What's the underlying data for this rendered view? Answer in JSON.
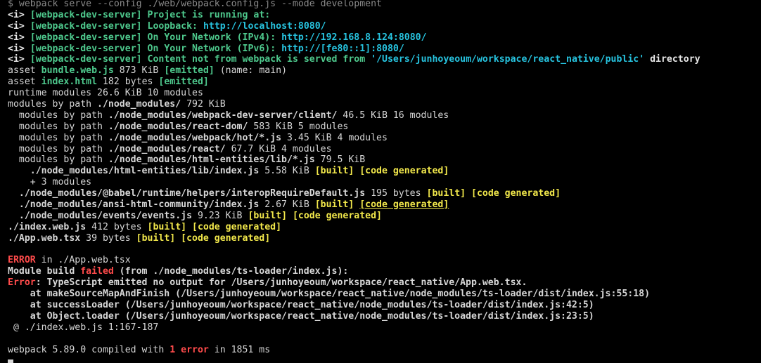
{
  "command": "$ webpack serve --config ./web/webpack.config.js --mode development",
  "info_prefix": "<i>",
  "server_tag": "[webpack-dev-server]",
  "lines": {
    "l1": "Project is running at:",
    "l2a": "Loopback: ",
    "l2b": "http://localhost:8080/",
    "l3a": "On Your Network (IPv4): ",
    "l3b": "http://192.168.8.124:8080/",
    "l4a": "On Your Network (IPv6): ",
    "l4b": "http://[fe80::1]:8080/",
    "l5a": "Content not from webpack is served from ",
    "l5b": "'/Users/junhoyeoum/workspace/react_native/public'",
    "l5c": " directory"
  },
  "assets": [
    {
      "prefix": "asset ",
      "name": "bundle.web.js",
      "size": " 873 KiB ",
      "tag": "[emitted]",
      "extra": " (name: main)"
    },
    {
      "prefix": "asset ",
      "name": "index.html",
      "size": " 182 bytes ",
      "tag": "[emitted]",
      "extra": ""
    }
  ],
  "runtime": "runtime modules 26.6 KiB 10 modules",
  "modules_by_path_root": {
    "label": "modules by path ",
    "path": "./node_modules/",
    "size": " 792 KiB"
  },
  "modules_by_path": [
    {
      "label": "  modules by path ",
      "path": "./node_modules/webpack-dev-server/client/",
      "size": " 46.5 KiB 16 modules"
    },
    {
      "label": "  modules by path ",
      "path": "./node_modules/react-dom/",
      "size": " 583 KiB 5 modules"
    },
    {
      "label": "  modules by path ",
      "path": "./node_modules/webpack/hot/*.js",
      "size": " 3.45 KiB 4 modules"
    },
    {
      "label": "  modules by path ",
      "path": "./node_modules/react/",
      "size": " 67.7 KiB 4 modules"
    },
    {
      "label": "  modules by path ",
      "path": "./node_modules/html-entities/lib/*.js",
      "size": " 79.5 KiB"
    }
  ],
  "built_modules": [
    {
      "indent": "    ",
      "path": "./node_modules/html-entities/lib/index.js",
      "size": " 5.58 KiB ",
      "built": "[built]",
      "gen": "[code generated]"
    },
    {
      "indent": "    ",
      "path": "+ 3 modules",
      "size": "",
      "built": "",
      "gen": ""
    },
    {
      "indent": "  ",
      "path": "./node_modules/@babel/runtime/helpers/interopRequireDefault.js",
      "size": " 195 bytes ",
      "built": "[built]",
      "gen": "[code generated]"
    },
    {
      "indent": "  ",
      "path": "./node_modules/ansi-html-community/index.js",
      "size": " 2.67 KiB ",
      "built": "[built]",
      "gen": "[code generated]"
    },
    {
      "indent": "  ",
      "path": "./node_modules/events/events.js",
      "size": " 9.23 KiB ",
      "built": "[built]",
      "gen": "[code generated]"
    },
    {
      "indent": "",
      "path": "./index.web.js",
      "size": " 412 bytes ",
      "built": "[built]",
      "gen": "[code generated]"
    },
    {
      "indent": "",
      "path": "./App.web.tsx",
      "size": " 39 bytes ",
      "built": "[built]",
      "gen": "[code generated]"
    }
  ],
  "error": {
    "label": "ERROR",
    "in": " in ./App.web.tsx",
    "build_a": "Module build ",
    "build_b": "failed",
    "build_c": " (from ./node_modules/ts-loader/index.js):",
    "err_label": "Error",
    "err_msg": ": TypeScript emitted no output for /Users/junhoyeoum/workspace/react_native/App.web.tsx.",
    "stack": [
      "    at makeSourceMapAndFinish (/Users/junhoyeoum/workspace/react_native/node_modules/ts-loader/dist/index.js:55:18)",
      "    at successLoader (/Users/junhoyeoum/workspace/react_native/node_modules/ts-loader/dist/index.js:42:5)",
      "    at Object.loader (/Users/junhoyeoum/workspace/react_native/node_modules/ts-loader/dist/index.js:23:5)"
    ],
    "at_line": " @ ./index.web.js 1:167-187"
  },
  "summary": {
    "a": "webpack 5.89.0 compiled with ",
    "b": "1 error",
    "c": " in 1851 ms"
  },
  "colors": {
    "green": "#4ec98d",
    "cyan": "#27c4e0",
    "yellow": "#f2e84b",
    "red": "#ff4b4b",
    "text": "#d6d6d6"
  }
}
